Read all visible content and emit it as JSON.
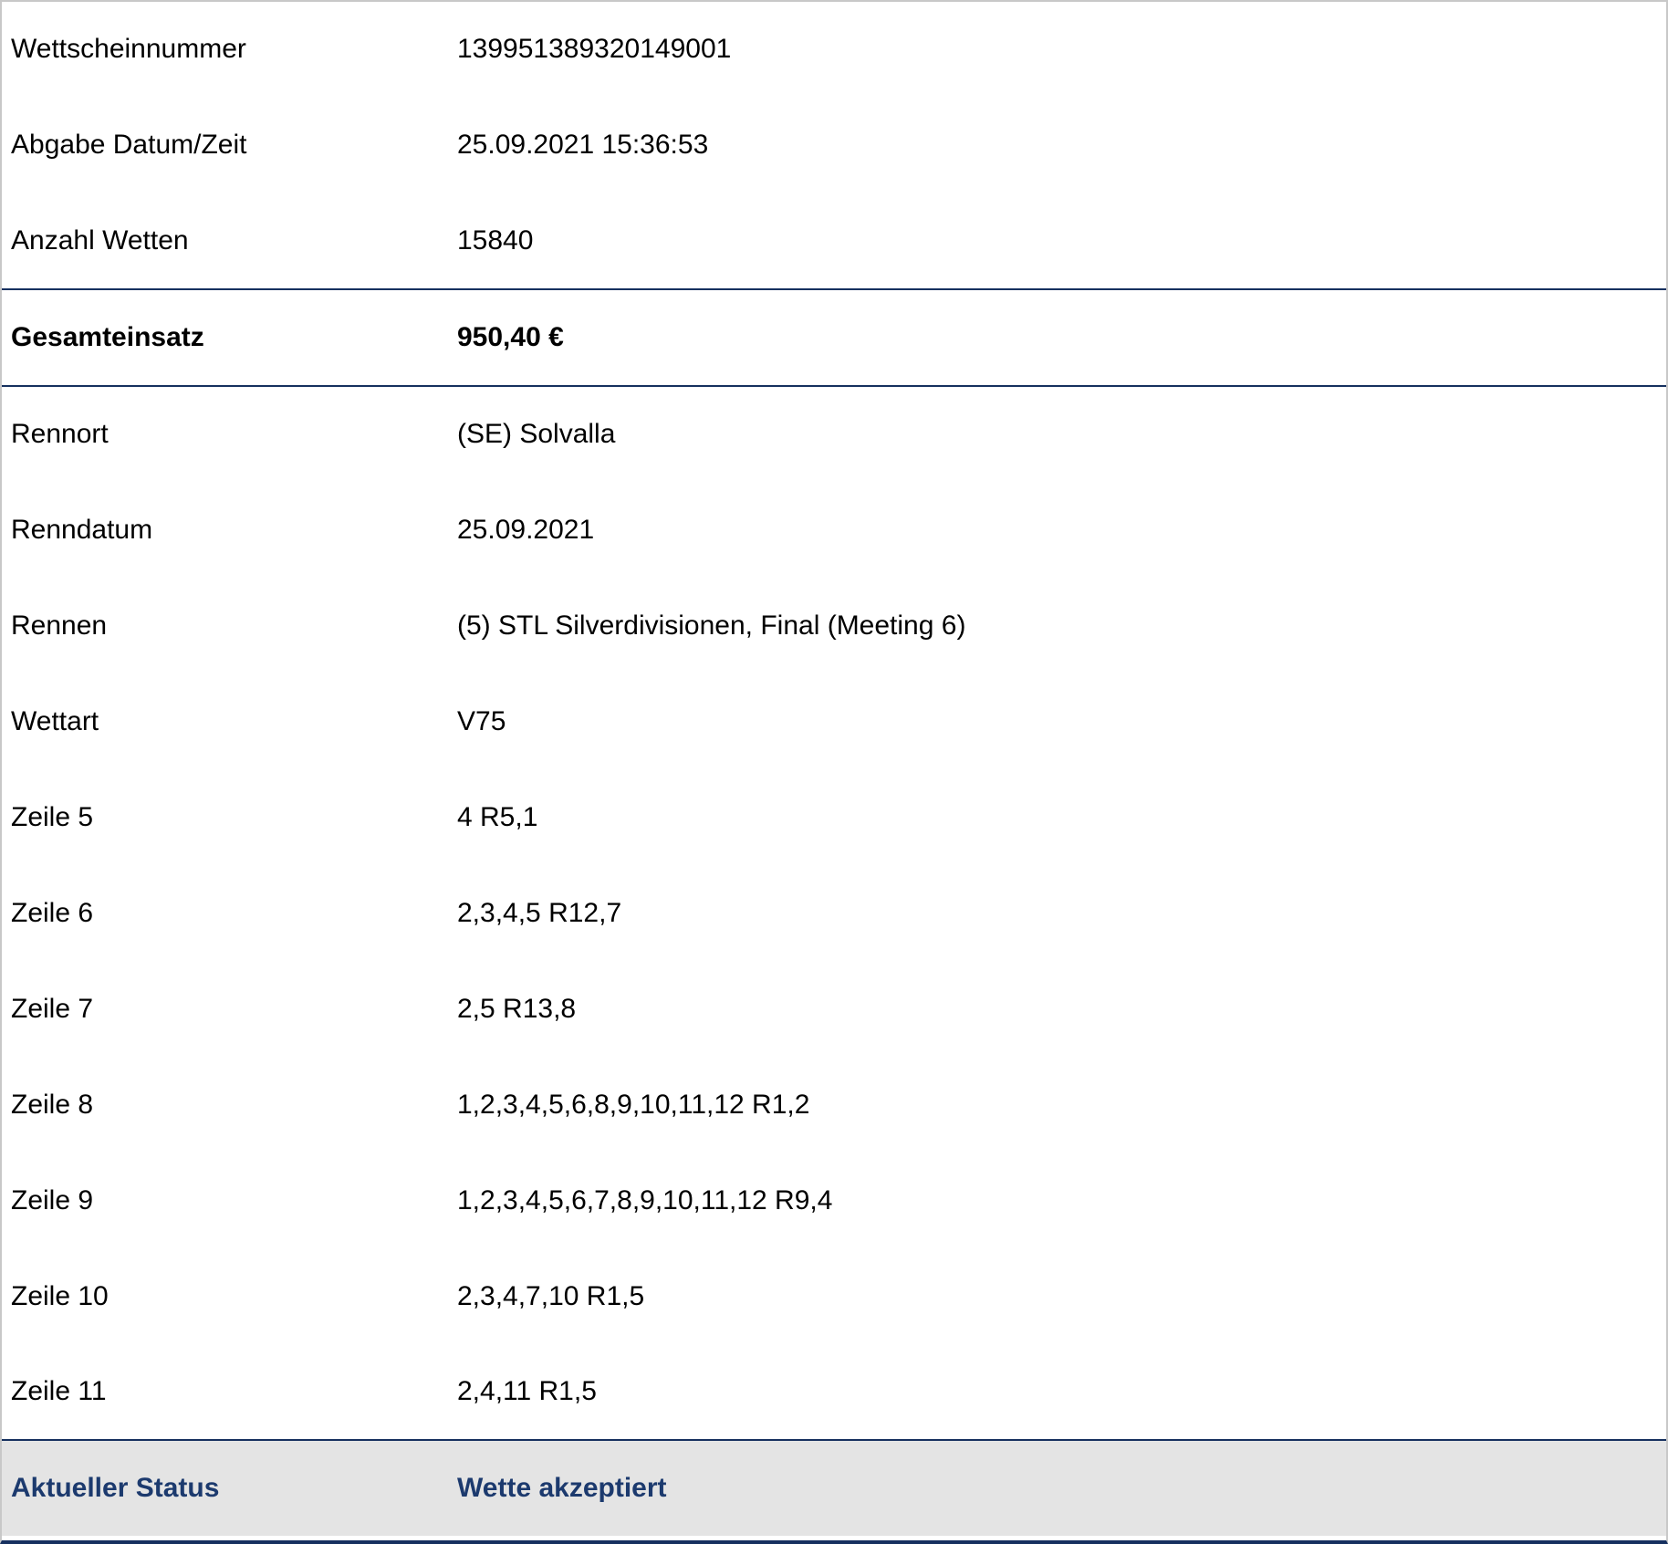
{
  "header_rows": [
    {
      "label": "Wettscheinnummer",
      "value": "139951389320149001"
    },
    {
      "label": "Abgabe Datum/Zeit",
      "value": "25.09.2021 15:36:53"
    },
    {
      "label": "Anzahl Wetten",
      "value": "15840"
    }
  ],
  "total": {
    "label": "Gesamteinsatz",
    "value": "950,40 €"
  },
  "race_rows": [
    {
      "label": "Rennort",
      "value": "(SE) Solvalla"
    },
    {
      "label": "Renndatum",
      "value": "25.09.2021"
    },
    {
      "label": "Rennen",
      "value": "(5) STL Silverdivisionen, Final (Meeting 6)"
    },
    {
      "label": "Wettart",
      "value": "V75"
    },
    {
      "label": "Zeile 5",
      "value": "4 R5,1"
    },
    {
      "label": "Zeile 6",
      "value": "2,3,4,5 R12,7"
    },
    {
      "label": "Zeile 7",
      "value": "2,5 R13,8"
    },
    {
      "label": "Zeile 8",
      "value": "1,2,3,4,5,6,8,9,10,11,12 R1,2"
    },
    {
      "label": "Zeile 9",
      "value": "1,2,3,4,5,6,7,8,9,10,11,12 R9,4"
    },
    {
      "label": "Zeile 10",
      "value": "2,3,4,7,10 R1,5"
    },
    {
      "label": "Zeile 11",
      "value": "2,4,11 R1,5"
    }
  ],
  "status": {
    "label": "Aktueller Status",
    "value": "Wette akzeptiert"
  },
  "colors": {
    "divider": "#16305f",
    "status_text": "#1c3a6e",
    "status_background": "#e4e4e4"
  }
}
